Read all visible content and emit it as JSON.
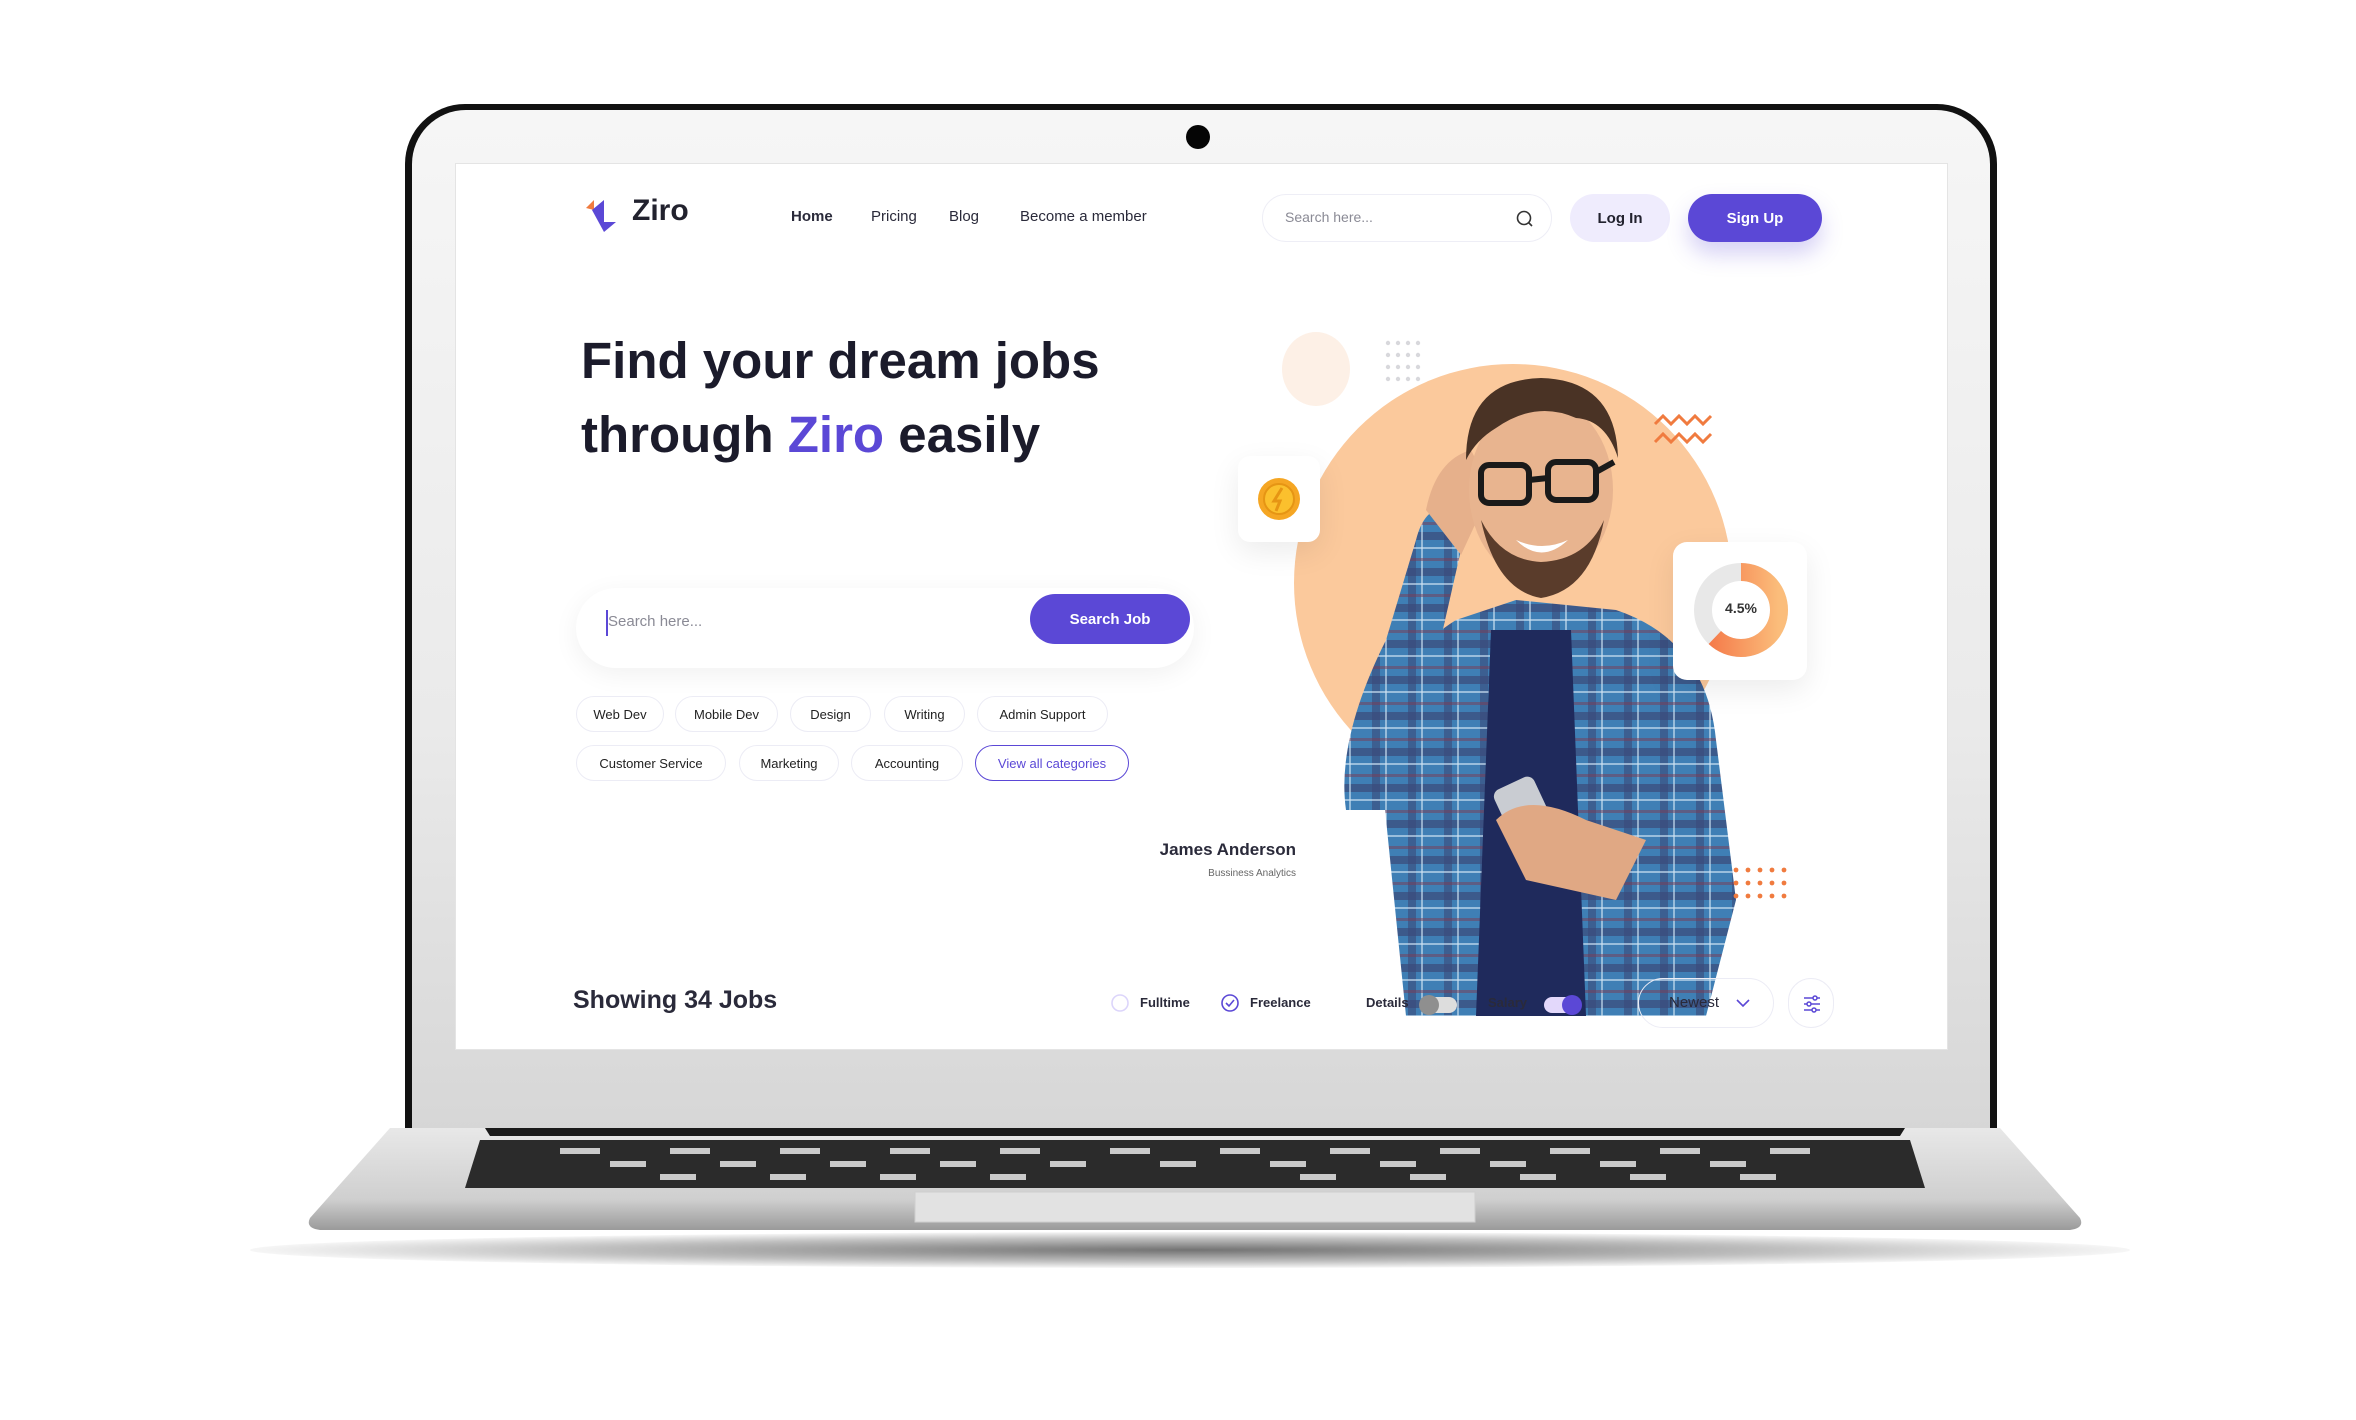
{
  "brand": {
    "name": "Ziro",
    "accent": "#5b48d6",
    "secondary": "#f07b3f"
  },
  "nav": {
    "links": [
      "Home",
      "Pricing",
      "Blog",
      "Become a member"
    ],
    "search_placeholder": "Search here...",
    "login_label": "Log In",
    "signup_label": "Sign Up"
  },
  "hero": {
    "title_line1": "Find your dream jobs",
    "title_line2_pre": "through ",
    "title_line2_brand": "Ziro",
    "title_line2_post": " easily",
    "search_placeholder": "Search here...",
    "search_button": "Search Job",
    "categories": [
      "Web Dev",
      "Mobile Dev",
      "Design",
      "Writing",
      "Admin Support",
      "Customer Service",
      "Marketing",
      "Accounting"
    ],
    "view_all_label": "View all categories"
  },
  "profile": {
    "name": "James Anderson",
    "role": "Bussiness Analytics",
    "stat_value": "4.5%",
    "stat_fraction": 0.62
  },
  "results": {
    "summary": "Showing 34 Jobs",
    "filters": [
      {
        "label": "Fulltime",
        "checked": false
      },
      {
        "label": "Freelance",
        "checked": true
      }
    ],
    "toggles": [
      {
        "label": "Details",
        "on": false
      },
      {
        "label": "Salary",
        "on": true
      }
    ],
    "sort_selected": "Newest"
  }
}
